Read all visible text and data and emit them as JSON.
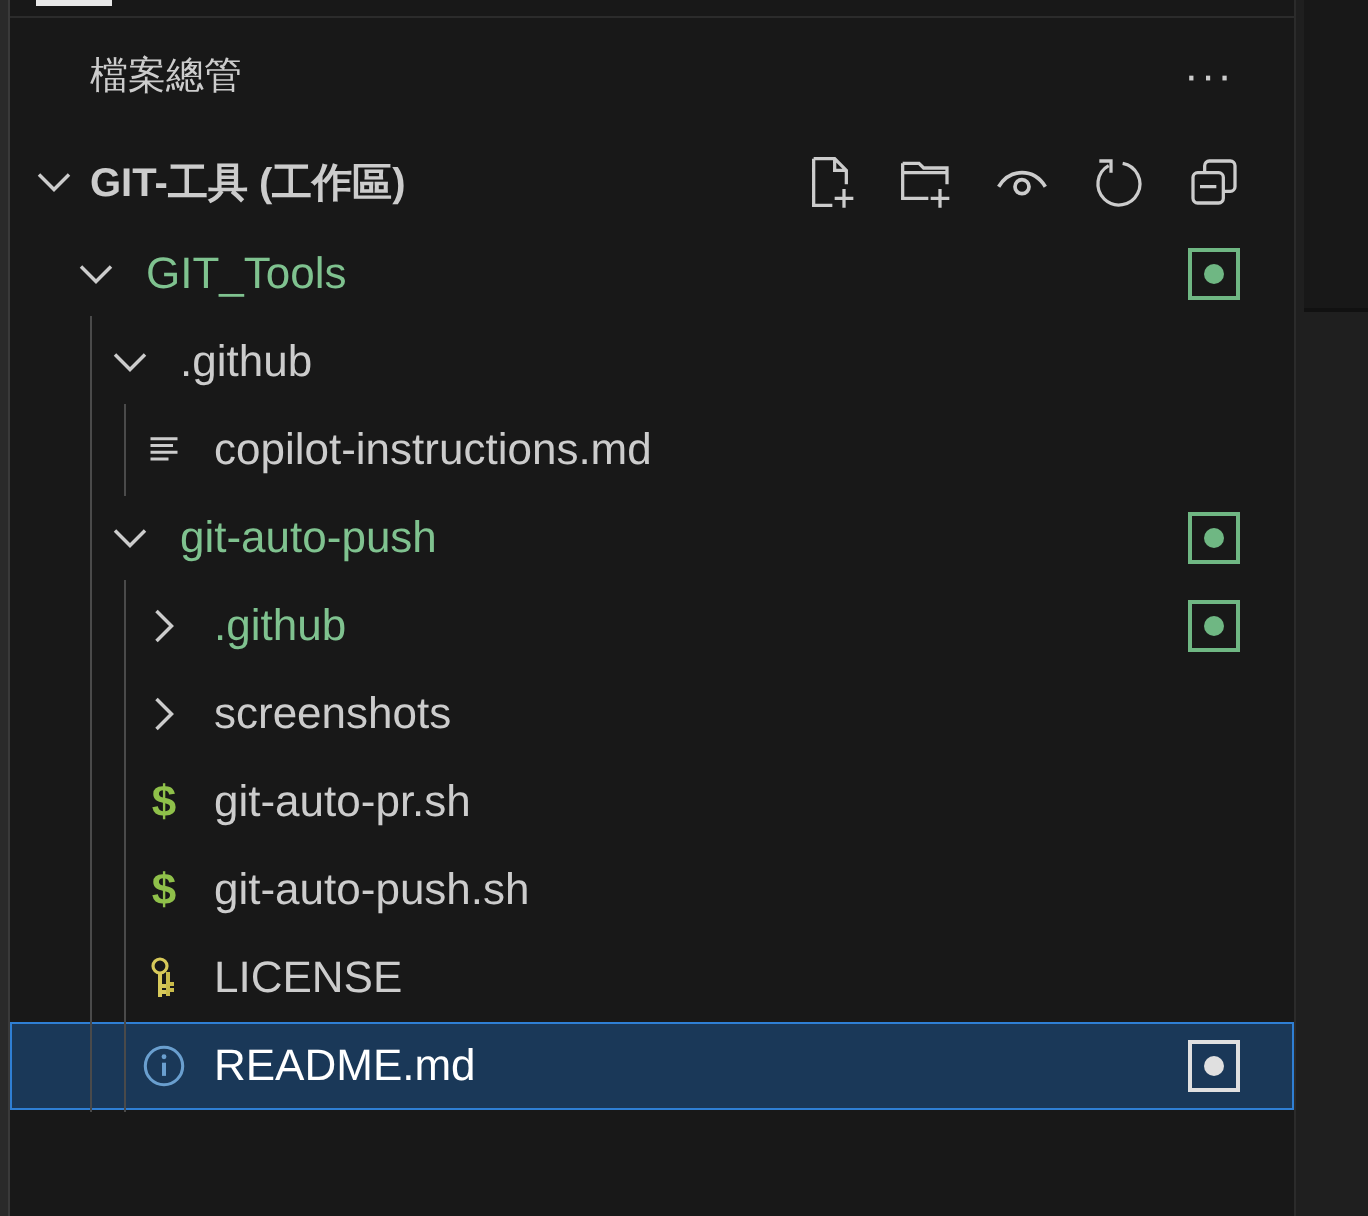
{
  "panel": {
    "title": "檔案總管",
    "more": "···"
  },
  "workspace": {
    "name": "GIT-工具 (工作區)",
    "expanded": true
  },
  "tree": [
    {
      "name": "GIT_Tools",
      "kind": "folder",
      "expanded": true,
      "modified": true,
      "selected": false,
      "children": [
        {
          "name": ".github",
          "kind": "folder",
          "expanded": true,
          "modified": false,
          "selected": false,
          "children": [
            {
              "name": "copilot-instructions.md",
              "kind": "markdown",
              "modified": false,
              "selected": false
            }
          ]
        },
        {
          "name": "git-auto-push",
          "kind": "folder",
          "expanded": true,
          "modified": true,
          "selected": false,
          "children": [
            {
              "name": ".github",
              "kind": "folder",
              "expanded": false,
              "modified": true,
              "selected": false
            },
            {
              "name": "screenshots",
              "kind": "folder",
              "expanded": false,
              "modified": false,
              "selected": false
            },
            {
              "name": "git-auto-pr.sh",
              "kind": "shell",
              "icon": "$",
              "modified": false,
              "selected": false
            },
            {
              "name": "git-auto-push.sh",
              "kind": "shell",
              "icon": "$",
              "modified": false,
              "selected": false
            },
            {
              "name": "LICENSE",
              "kind": "license",
              "modified": false,
              "selected": false
            },
            {
              "name": "README.md",
              "kind": "info",
              "modified": true,
              "selected": true
            }
          ]
        }
      ]
    }
  ]
}
